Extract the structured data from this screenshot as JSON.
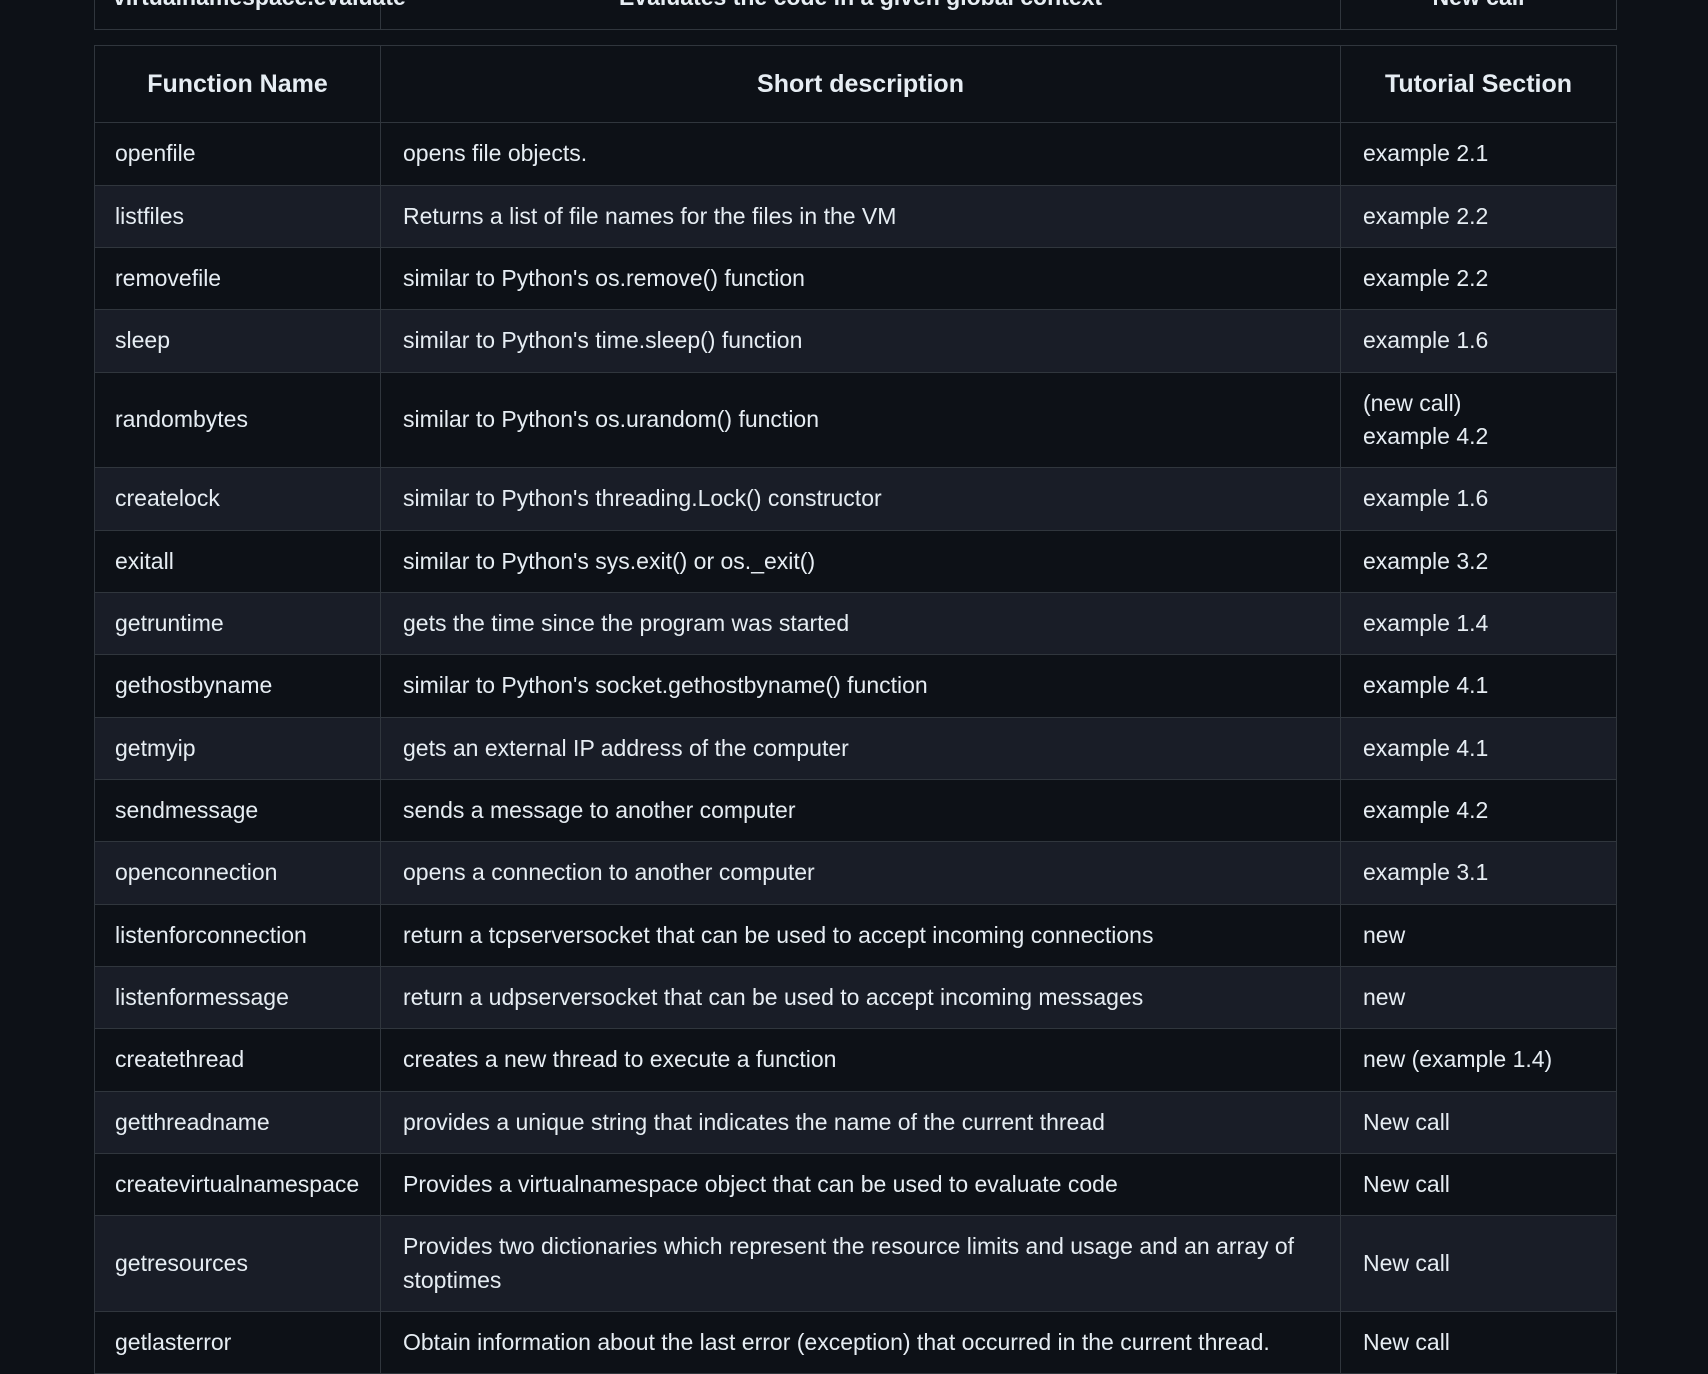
{
  "colors": {
    "page_background": "#0d1117",
    "row_dark": "#0d1117",
    "row_light": "#191d27",
    "border": "#30363d",
    "text": "#e6edf3"
  },
  "previous_table_fragment": {
    "function_name": "virtualnamespace.evaluate",
    "short_description": "Evaluates the code in a given global context",
    "tutorial_section": "New call"
  },
  "main_table": {
    "headers": {
      "function_name": "Function Name",
      "short_description": "Short description",
      "tutorial_section": "Tutorial Section"
    },
    "rows": [
      {
        "name": "openfile",
        "desc": "opens file objects.",
        "section": "example 2.1"
      },
      {
        "name": "listfiles",
        "desc": "Returns a list of file names for the files in the VM",
        "section": "example 2.2"
      },
      {
        "name": "removefile",
        "desc": "similar to Python's os.remove() function",
        "section": "example 2.2"
      },
      {
        "name": "sleep",
        "desc": "similar to Python's time.sleep() function",
        "section": "example 1.6"
      },
      {
        "name": "randombytes",
        "desc": "similar to Python's os.urandom() function",
        "section": "(new call)\nexample 4.2"
      },
      {
        "name": "createlock",
        "desc": "similar to Python's threading.Lock() constructor",
        "section": "example 1.6"
      },
      {
        "name": "exitall",
        "desc": "similar to Python's sys.exit() or os._exit()",
        "section": "example 3.2"
      },
      {
        "name": "getruntime",
        "desc": "gets the time since the program was started",
        "section": "example 1.4"
      },
      {
        "name": "gethostbyname",
        "desc": "similar to Python's socket.gethostbyname() function",
        "section": "example 4.1"
      },
      {
        "name": "getmyip",
        "desc": "gets an external IP address of the computer",
        "section": "example 4.1"
      },
      {
        "name": "sendmessage",
        "desc": "sends a message to another computer",
        "section": "example 4.2"
      },
      {
        "name": "openconnection",
        "desc": "opens a connection to another computer",
        "section": "example 3.1"
      },
      {
        "name": "listenforconnection",
        "desc": "return a tcpserversocket that can be used to accept incoming connections",
        "section": "new"
      },
      {
        "name": "listenformessage",
        "desc": "return a udpserversocket that can be used to accept incoming messages",
        "section": "new"
      },
      {
        "name": "createthread",
        "desc": "creates a new thread to execute a function",
        "section": "new (example 1.4)"
      },
      {
        "name": "getthreadname",
        "desc": "provides a unique string that indicates the name of the current thread",
        "section": "New call"
      },
      {
        "name": "createvirtualnamespace",
        "desc": "Provides a virtualnamespace object that can be used to evaluate code",
        "section": "New call"
      },
      {
        "name": "getresources",
        "desc": "Provides two dictionaries which represent the resource limits and usage and an array of stoptimes",
        "section": "New call"
      },
      {
        "name": "getlasterror",
        "desc": "Obtain information about the last error (exception) that occurred in the current thread.",
        "section": "New call"
      }
    ]
  }
}
